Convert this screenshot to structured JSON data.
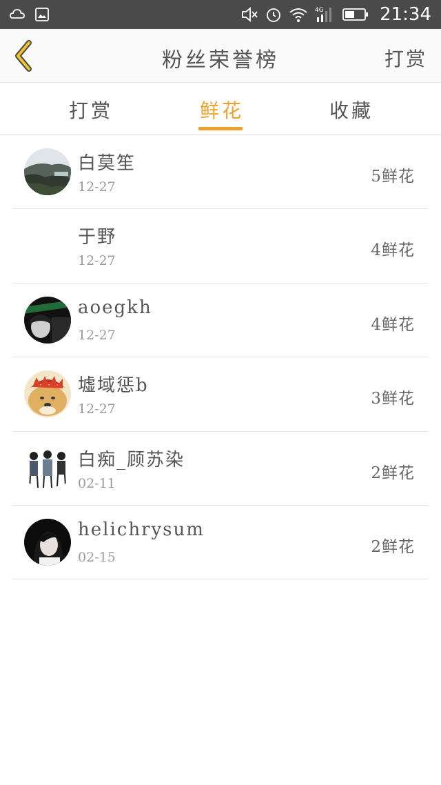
{
  "status_bar": {
    "time": "21:34",
    "network": "4G"
  },
  "nav": {
    "title": "粉丝荣誉榜",
    "action": "打赏"
  },
  "tabs": [
    {
      "label": "打赏",
      "active": false
    },
    {
      "label": "鲜花",
      "active": true
    },
    {
      "label": "收藏",
      "active": false
    }
  ],
  "colors": {
    "accent": "#eda12c",
    "status_bar": "#4a4a4a",
    "text": "#555555",
    "muted": "#9a9a9a"
  },
  "fans": [
    {
      "name": "白莫笙",
      "date": "12-27",
      "count": "5鲜花",
      "avatar": "landscape-photo"
    },
    {
      "name": "于野",
      "date": "12-27",
      "count": "4鲜花",
      "avatar": "none"
    },
    {
      "name": "aoegkh",
      "date": "12-27",
      "count": "4鲜花",
      "avatar": "dark-portrait"
    },
    {
      "name": "墟域惩b",
      "date": "12-27",
      "count": "3鲜花",
      "avatar": "doge-cartoon"
    },
    {
      "name": "白痴_顾苏染",
      "date": "02-11",
      "count": "2鲜花",
      "avatar": "sketch-figures"
    },
    {
      "name": "helichrysum",
      "date": "02-15",
      "count": "2鲜花",
      "avatar": "girl-portrait"
    }
  ]
}
